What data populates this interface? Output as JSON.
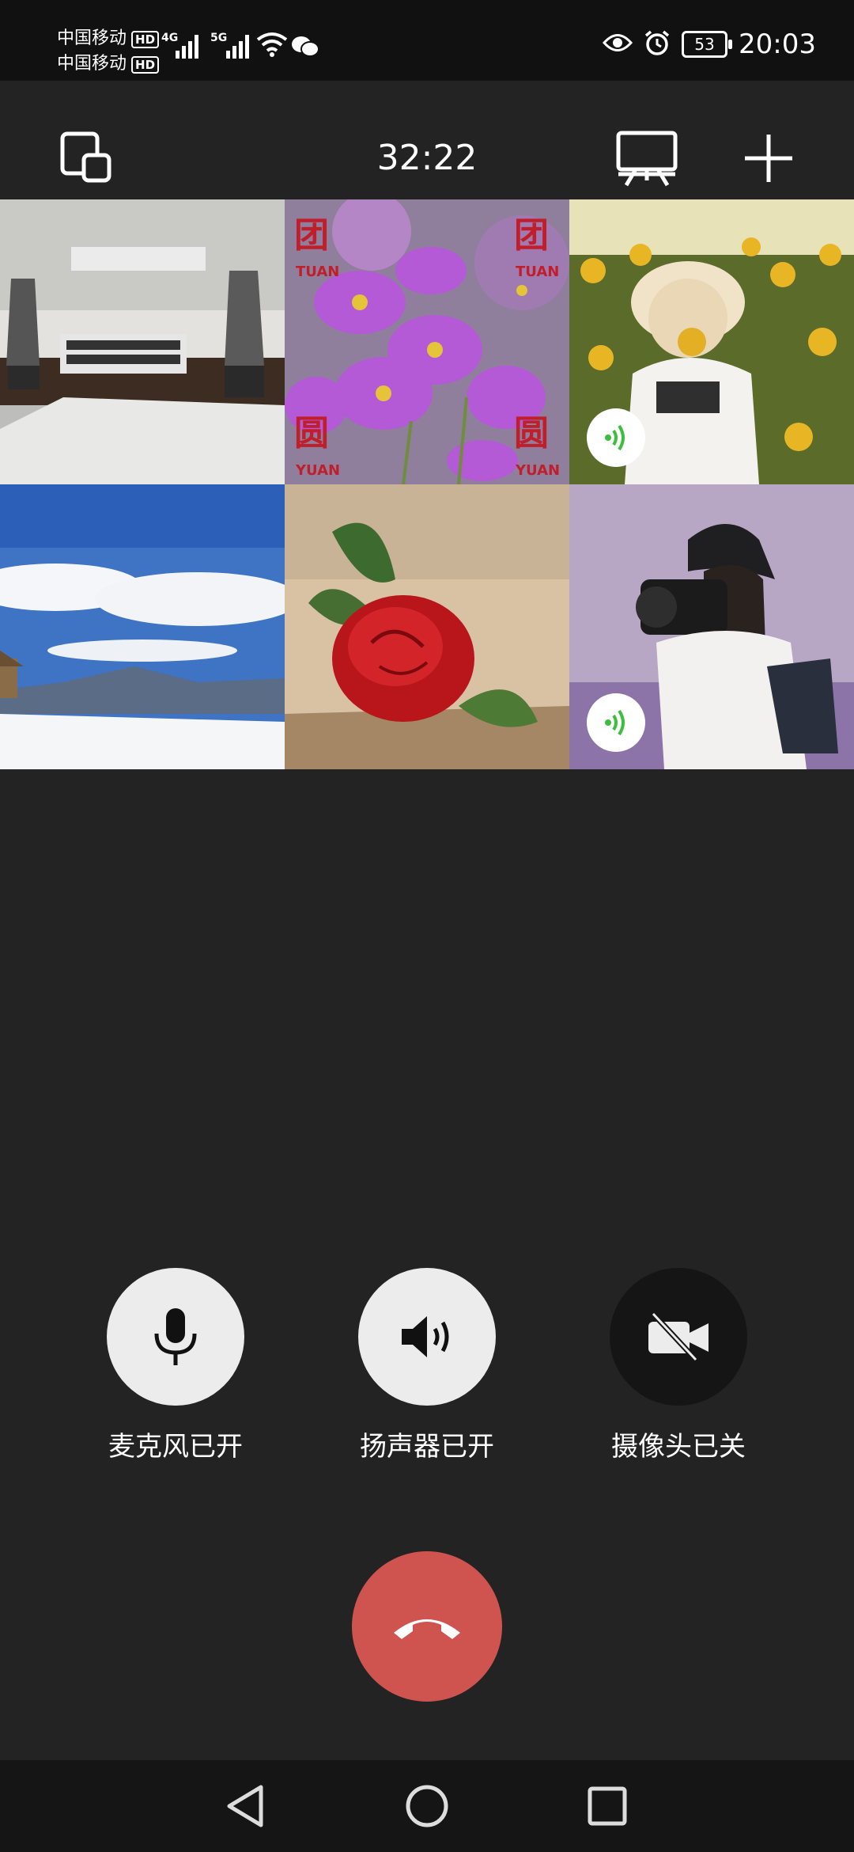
{
  "status_bar": {
    "carrier1": "中国移动",
    "carrier2": "中国移动",
    "hd_badge": "HD",
    "net1": "4G",
    "net2": "5G",
    "battery": "53",
    "time": "20:03"
  },
  "top_bar": {
    "timer": "32:22"
  },
  "participants": [
    {
      "name": "living-room",
      "audio_active": false
    },
    {
      "name": "cosmos-flowers",
      "audio_active": false,
      "watermark": "团",
      "watermark_sub": "TUAN",
      "watermark2": "圆",
      "watermark2_sub": "YUAN"
    },
    {
      "name": "sunflower-girl",
      "audio_active": true
    },
    {
      "name": "mountain-snow",
      "audio_active": false
    },
    {
      "name": "red-rose",
      "audio_active": false
    },
    {
      "name": "photographer-girl",
      "audio_active": true
    }
  ],
  "controls": {
    "mic_label": "麦克风已开",
    "speaker_label": "扬声器已开",
    "camera_label": "摄像头已关"
  },
  "colors": {
    "background": "#232323",
    "hangup": "#cf5450",
    "audio_green": "#3cbf3c"
  }
}
